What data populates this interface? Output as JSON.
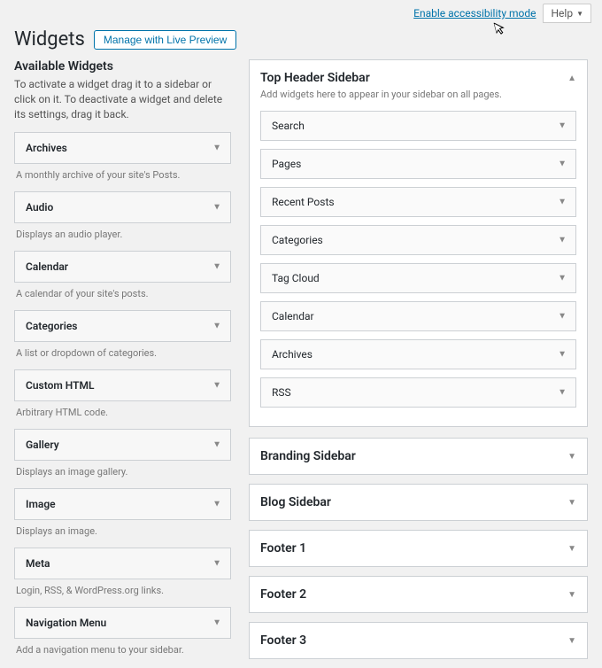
{
  "top": {
    "accessibility_link": "Enable accessibility mode",
    "help_label": "Help"
  },
  "header": {
    "page_title": "Widgets",
    "manage_button": "Manage with Live Preview"
  },
  "available": {
    "heading": "Available Widgets",
    "description": "To activate a widget drag it to a sidebar or click on it. To deactivate a widget and delete its settings, drag it back.",
    "items": [
      {
        "name": "Archives",
        "desc": "A monthly archive of your site's Posts."
      },
      {
        "name": "Audio",
        "desc": "Displays an audio player."
      },
      {
        "name": "Calendar",
        "desc": "A calendar of your site's posts."
      },
      {
        "name": "Categories",
        "desc": "A list or dropdown of categories."
      },
      {
        "name": "Custom HTML",
        "desc": "Arbitrary HTML code."
      },
      {
        "name": "Gallery",
        "desc": "Displays an image gallery."
      },
      {
        "name": "Image",
        "desc": "Displays an image."
      },
      {
        "name": "Meta",
        "desc": "Login, RSS, & WordPress.org links."
      },
      {
        "name": "Navigation Menu",
        "desc": "Add a navigation menu to your sidebar."
      }
    ]
  },
  "top_sidebar": {
    "title": "Top Header Sidebar",
    "desc": "Add widgets here to appear in your sidebar on all pages.",
    "widgets": [
      "Search",
      "Pages",
      "Recent Posts",
      "Categories",
      "Tag Cloud",
      "Calendar",
      "Archives",
      "RSS"
    ]
  },
  "collapsed_sidebars": [
    "Branding Sidebar",
    "Blog Sidebar",
    "Footer 1",
    "Footer 2",
    "Footer 3"
  ]
}
